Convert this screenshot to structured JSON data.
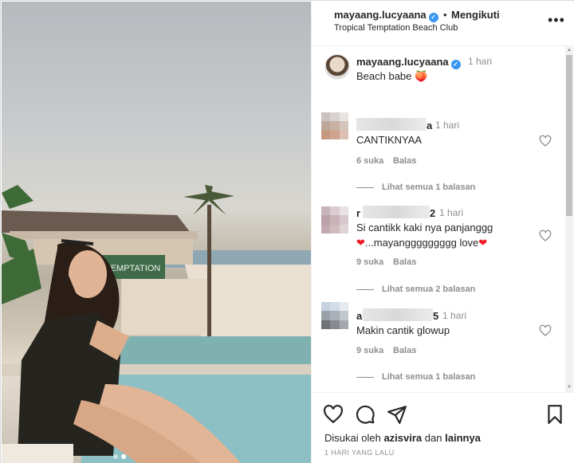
{
  "header": {
    "username": "mayaang.lucyaana",
    "verified_icon": "verified-badge-icon",
    "separator": "•",
    "follow_status": "Mengikuti",
    "location": "Tropical Temptation Beach Club",
    "more_icon": "more-options-icon"
  },
  "photo": {
    "sign_text": "TEMPTATION",
    "carousel_dots": 2,
    "active_dot": 2
  },
  "caption": {
    "username": "mayaang.lucyaana",
    "time": "1 hari",
    "text": "Beach babe",
    "emoji": "🍑"
  },
  "comments": [
    {
      "username_visible_end": "a",
      "time": "1 hari",
      "text_lines": [
        "CANTIKNYAA"
      ],
      "likes": "6 suka",
      "reply_label": "Balas",
      "view_replies": "Lihat semua 1 balasan"
    },
    {
      "username_visible_start": "r",
      "username_visible_end": "2",
      "time": "1 hari",
      "text_lines": [
        "Si cantikk kaki nya panjanggg",
        "...mayanggggggggg love"
      ],
      "likes": "9 suka",
      "reply_label": "Balas",
      "view_replies": "Lihat semua 2 balasan"
    },
    {
      "username_visible_start": "a",
      "username_visible_end": "5",
      "time": "1 hari",
      "text_lines": [
        "Makin cantik glowup"
      ],
      "likes": "9 suka",
      "reply_label": "Balas",
      "view_replies": "Lihat semua 1 balasan"
    }
  ],
  "actions": {
    "liked_by_prefix": "Disukai oleh",
    "liked_by_user": "azisvira",
    "liked_by_and": "dan",
    "liked_by_others": "lainnya",
    "date": "1 HARI YANG LALU"
  },
  "colors": {
    "accent": "#3897f0",
    "muted": "#8e8e8e",
    "text": "#262626",
    "heart": "#ed1c24"
  }
}
